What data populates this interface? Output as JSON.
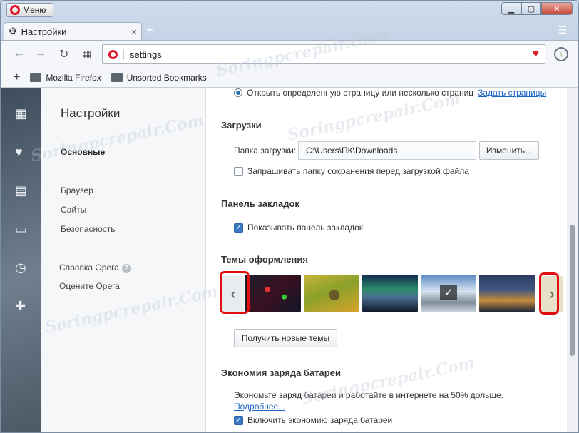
{
  "window": {
    "menu_label": "Меню",
    "tab_title": "Настройки",
    "tab_close": "×",
    "new_tab": "+"
  },
  "toolbar": {
    "address": "settings"
  },
  "bookmarks": {
    "add": "+",
    "items": [
      "Mozilla Firefox",
      "Unsorted Bookmarks"
    ]
  },
  "nav": {
    "title": "Настройки",
    "basic": "Основные",
    "browser": "Браузер",
    "sites": "Сайты",
    "security": "Безопасность",
    "help": "Справка Opera",
    "rate": "Оцените Opera"
  },
  "content": {
    "startup_option": "Открыть определенную страницу или несколько страниц",
    "set_pages_link": "Задать страницы",
    "downloads_title": "Загрузки",
    "download_folder_label": "Папка загрузки:",
    "download_path": "C:\\Users\\ПК\\Downloads",
    "change_button": "Изменить...",
    "ask_folder_label": "Запрашивать папку сохранения перед загрузкой файла",
    "bookmarks_panel_title": "Панель закладок",
    "show_bookmarks_label": "Показывать панель закладок",
    "themes_title": "Темы оформления",
    "get_themes_button": "Получить новые темы",
    "battery_title": "Экономия заряда батареи",
    "battery_desc": "Экономьте заряд батареи и работайте в интернете на 50% дольше.",
    "more_link": "Подробнее...",
    "enable_battery_label": "Включить экономию заряда батареи"
  },
  "watermark": "Soringpcrepair.Com",
  "colors": {
    "accent": "#3b79c4",
    "opera_red": "#e1172b",
    "highlight_red": "#e01010"
  }
}
